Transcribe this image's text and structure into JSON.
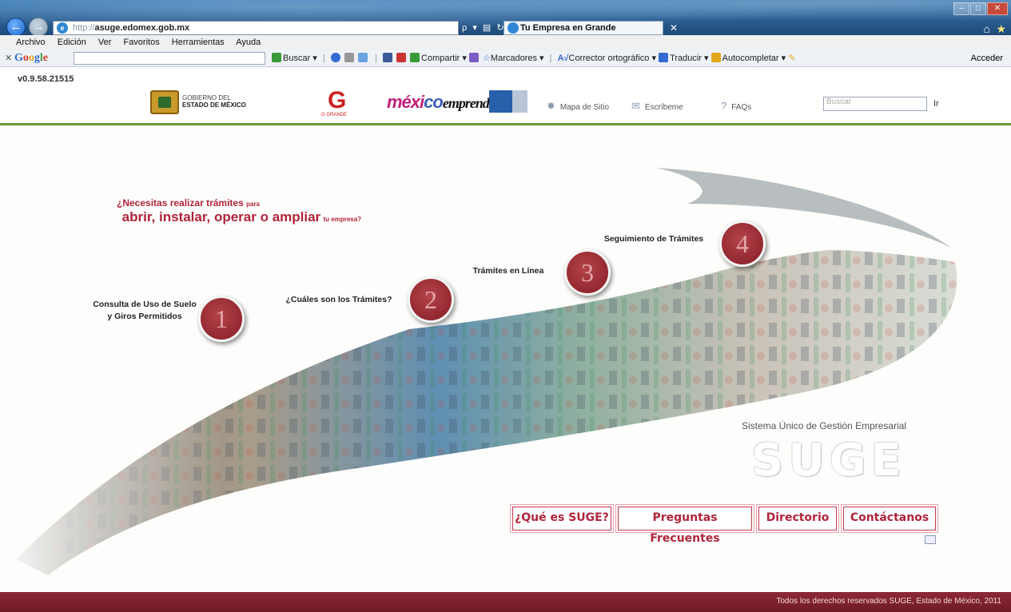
{
  "browser": {
    "url_protocol": "http://",
    "url_host": "asuge.edomex.gob.mx",
    "address_tools": "ρ ▾ ▤ ↻ ✕",
    "tab_title": "Tu Empresa en Grande",
    "menu": [
      "Archivo",
      "Edición",
      "Ver",
      "Favoritos",
      "Herramientas",
      "Ayuda"
    ],
    "google_toolbar": {
      "logo": "Google",
      "search": "Buscar ▾",
      "share": "Compartir ▾",
      "bookmarks": "Marcadores ▾",
      "spell": "Corrector ortográfico ▾",
      "translate": "Traducir ▾",
      "autofill": "Autocompletar ▾",
      "signin": "Acceder"
    }
  },
  "header": {
    "version": "v0.9.58.21515",
    "gobierno_line1": "GOBIERNO DEL",
    "gobierno_line2": "ESTADO DE MÉXICO",
    "g_grande_text": "G GRANDE",
    "mexico_emprende_a": "méxi",
    "mexico_emprende_b": "co",
    "mexico_emprende_c": "emprende",
    "mapa_sitio": "Mapa de Sitio",
    "escribeme": "Escríbeme",
    "faqs": "FAQs",
    "search_placeholder": "Buscar",
    "search_button": "Ir"
  },
  "hero": {
    "question_line1": "¿Necesitas realizar trámites",
    "question_para": "para",
    "question_line2": "abrir, instalar, operar o ampliar",
    "question_tail": "tu empresa?",
    "steps": [
      {
        "number": "1",
        "label_line1": "Consulta de Uso de Suelo",
        "label_line2": "y Giros Permitidos"
      },
      {
        "number": "2",
        "label_line1": "¿Cuáles son los Trámites?"
      },
      {
        "number": "3",
        "label_line1": "Trámites en Línea"
      },
      {
        "number": "4",
        "label_line1": "Seguimiento de Trámites"
      }
    ],
    "suge_subtitle": "Sistema Único de Gestión Empresarial",
    "suge_logo": "SUGE"
  },
  "nav_buttons": {
    "que_es": "¿Qué es SUGE?",
    "preguntas": "Preguntas Frecuentes",
    "directorio": "Directorio",
    "contactanos": "Contáctanos"
  },
  "footer": {
    "text": "Todos los derechos reservados SUGE, Estado de México, 2011"
  },
  "colors": {
    "brand_red": "#b0243a",
    "footer_bg": "#7c2230",
    "header_rule": "#6c9a3a",
    "titlebar": "#2a5f93"
  }
}
